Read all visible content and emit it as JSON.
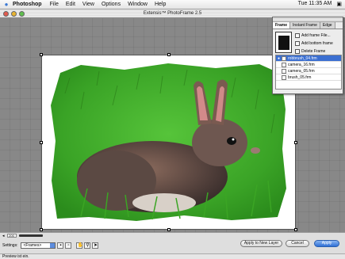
{
  "menubar": {
    "app": "Photoshop",
    "items": [
      "File",
      "Edit",
      "View",
      "Options",
      "Window",
      "Help"
    ],
    "clock": "Tue 11:35 AM"
  },
  "window": {
    "title": "Extensis™ PhotoFrame 2.5"
  },
  "panel": {
    "tabs": [
      "Frame",
      "Instant Frame",
      "Edge"
    ],
    "buttons": [
      "Add frame File...",
      "Add bottom frame",
      "Delete Frame"
    ],
    "frames": [
      "robbrush_04.frm",
      "camera_16.frm",
      "camera_05.frm",
      "brush_05.frm"
    ]
  },
  "bottom": {
    "zoom": "200",
    "settings_label": "Settings:",
    "settings_value": "<Frames>",
    "apply_new_layer": "Apply to New Layer",
    "cancel": "Cancel",
    "apply": "Apply",
    "status": "Preview ist ein."
  },
  "colors": {
    "accent": "#2f6fd5",
    "selection": "#3b6fd1"
  }
}
